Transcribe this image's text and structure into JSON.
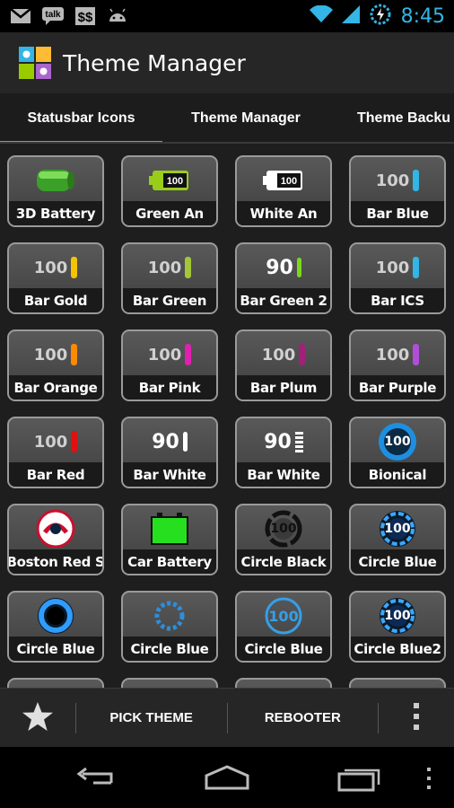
{
  "status_bar": {
    "left_icons": [
      "gmail-icon",
      "talk-icon",
      "dollar-icon",
      "android-icon"
    ],
    "talk_label": "talk",
    "dollar_label": "$$",
    "time": "8:45"
  },
  "action_bar": {
    "title": "Theme Manager"
  },
  "tabs": [
    {
      "label": "Statusbar Icons",
      "active": true
    },
    {
      "label": "Theme Manager",
      "active": false
    },
    {
      "label": "Theme Backu",
      "active": false
    }
  ],
  "tiles": [
    {
      "label": "3D Battery",
      "icon": "3d-battery-icon"
    },
    {
      "label": "Green      An",
      "icon": "green-battery-icon",
      "num": "100"
    },
    {
      "label": "White      An",
      "icon": "white-battery-icon",
      "num": "100"
    },
    {
      "label": "Bar Blue",
      "icon": "bar-icon",
      "num": "100",
      "color": "#33b5e5"
    },
    {
      "label": "Bar Gold",
      "icon": "bar-icon",
      "num": "100",
      "color": "#f5c400"
    },
    {
      "label": "Bar Green",
      "icon": "bar-icon",
      "num": "100",
      "color": "#a4c639"
    },
    {
      "label": "Bar Green 2",
      "icon": "bar-icon",
      "num": "90",
      "color": "#7cd81c"
    },
    {
      "label": "Bar ICS",
      "icon": "bar-icon",
      "num": "100",
      "color": "#33b5e5"
    },
    {
      "label": "Bar Orange",
      "icon": "bar-icon",
      "num": "100",
      "color": "#ff8a00"
    },
    {
      "label": "Bar Pink",
      "icon": "bar-icon",
      "num": "100",
      "color": "#e020b0"
    },
    {
      "label": "Bar Plum",
      "icon": "bar-icon",
      "num": "100",
      "color": "#a0207a"
    },
    {
      "label": "Bar Purple",
      "icon": "bar-icon",
      "num": "100",
      "color": "#b04ed8"
    },
    {
      "label": "Bar Red",
      "icon": "bar-icon",
      "num": "100",
      "color": "#e01010"
    },
    {
      "label": "Bar White",
      "icon": "bar-icon",
      "num": "90",
      "color": "#ffffff"
    },
    {
      "label": "Bar White",
      "icon": "segmented-bar-icon",
      "num": "90",
      "color": "#ffffff"
    },
    {
      "label": "Bionical",
      "icon": "bionical-circle-icon",
      "num": "100",
      "color": "#1e8fe0"
    },
    {
      "label": "Boston Red S",
      "icon": "boston-red-sox-icon"
    },
    {
      "label": "Car Battery",
      "icon": "car-battery-icon",
      "color": "#26e020"
    },
    {
      "label": "Circle Black",
      "icon": "circle-black-icon",
      "num": "100"
    },
    {
      "label": "Circle Blue",
      "icon": "circle-blue-glow-icon",
      "num": "100"
    },
    {
      "label": "Circle Blue",
      "icon": "circle-blue-ring-icon"
    },
    {
      "label": "Circle Blue",
      "icon": "circle-blue-dotted-icon"
    },
    {
      "label": "Circle Blue",
      "icon": "circle-blue-outline-icon",
      "num": "100"
    },
    {
      "label": "Circle Blue2",
      "icon": "circle-blue2-icon",
      "num": "100"
    }
  ],
  "bottom_bar": {
    "pick_theme": "PICK THEME",
    "rebooter": "REBOOTER"
  },
  "colors": {
    "accent": "#33b5e5",
    "tile_bg": "#4a4a4a"
  }
}
